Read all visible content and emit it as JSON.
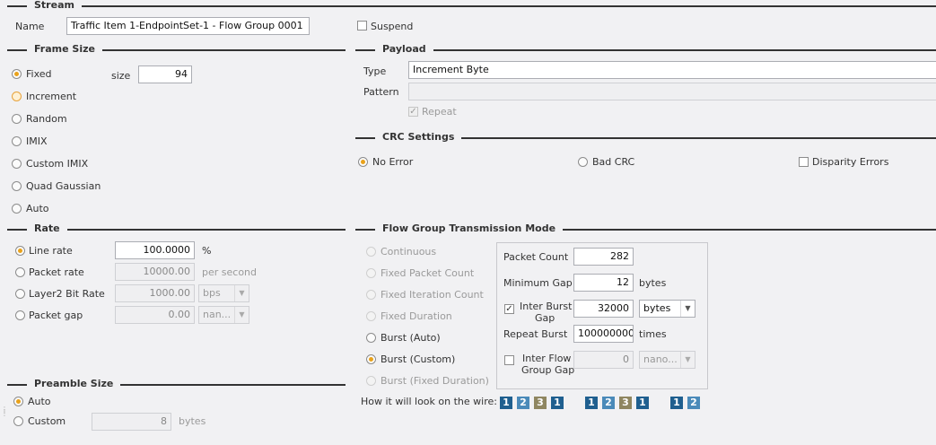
{
  "sections": {
    "stream": "Stream",
    "frame_size": "Frame Size",
    "payload": "Payload",
    "crc": "CRC Settings",
    "rate": "Rate",
    "flow_group": "Flow Group Transmission Mode",
    "preamble": "Preamble Size"
  },
  "stream": {
    "name_label": "Name",
    "name_value": "Traffic Item 1-EndpointSet-1 - Flow Group 0001",
    "suspend_label": "Suspend"
  },
  "frame_size": {
    "options": [
      "Fixed",
      "Increment",
      "Random",
      "IMIX",
      "Custom IMIX",
      "Quad Gaussian",
      "Auto"
    ],
    "selected": "Fixed",
    "size_label": "size",
    "size_value": "94"
  },
  "payload": {
    "type_label": "Type",
    "type_value": "Increment Byte",
    "pattern_label": "Pattern",
    "pattern_value": "",
    "repeat_label": "Repeat"
  },
  "crc": {
    "options": [
      "No Error",
      "Bad CRC"
    ],
    "selected": "No Error",
    "disparity_label": "Disparity Errors"
  },
  "rate": {
    "line_rate_label": "Line rate",
    "line_rate_value": "100.0000",
    "line_rate_unit": "%",
    "packet_rate_label": "Packet rate",
    "packet_rate_value": "10000.00",
    "packet_rate_unit": "per second",
    "l2_label": "Layer2 Bit Rate",
    "l2_value": "1000.00",
    "l2_unit": "bps",
    "gap_label": "Packet gap",
    "gap_value": "0.00",
    "gap_unit": "nan...",
    "selected": "Line rate"
  },
  "flow_group": {
    "modes": [
      "Continuous",
      "Fixed Packet Count",
      "Fixed Iteration Count",
      "Fixed Duration",
      "Burst (Auto)",
      "Burst (Custom)",
      "Burst (Fixed Duration)"
    ],
    "selected": "Burst (Custom)",
    "packet_count_label": "Packet Count",
    "packet_count_value": "282",
    "min_gap_label": "Minimum Gap",
    "min_gap_value": "12",
    "min_gap_unit": "bytes",
    "ibg_label_1": "Inter Burst",
    "ibg_label_2": "Gap",
    "ibg_value": "32000",
    "ibg_unit": "bytes",
    "repeat_burst_label": "Repeat Burst",
    "repeat_burst_value": "100000000",
    "repeat_burst_unit": "times",
    "ifg_label_1": "Inter Flow",
    "ifg_label_2": "Group Gap",
    "ifg_value": "0",
    "ifg_unit": "nano...",
    "wire_label": "How it will look on the wire:"
  },
  "wire_sequence": [
    "1",
    "2",
    "3",
    "1",
    "1",
    "2",
    "3",
    "1",
    "1",
    "2"
  ],
  "preamble": {
    "auto_label": "Auto",
    "custom_label": "Custom",
    "custom_value": "8",
    "unit": "bytes",
    "selected": "Auto"
  }
}
